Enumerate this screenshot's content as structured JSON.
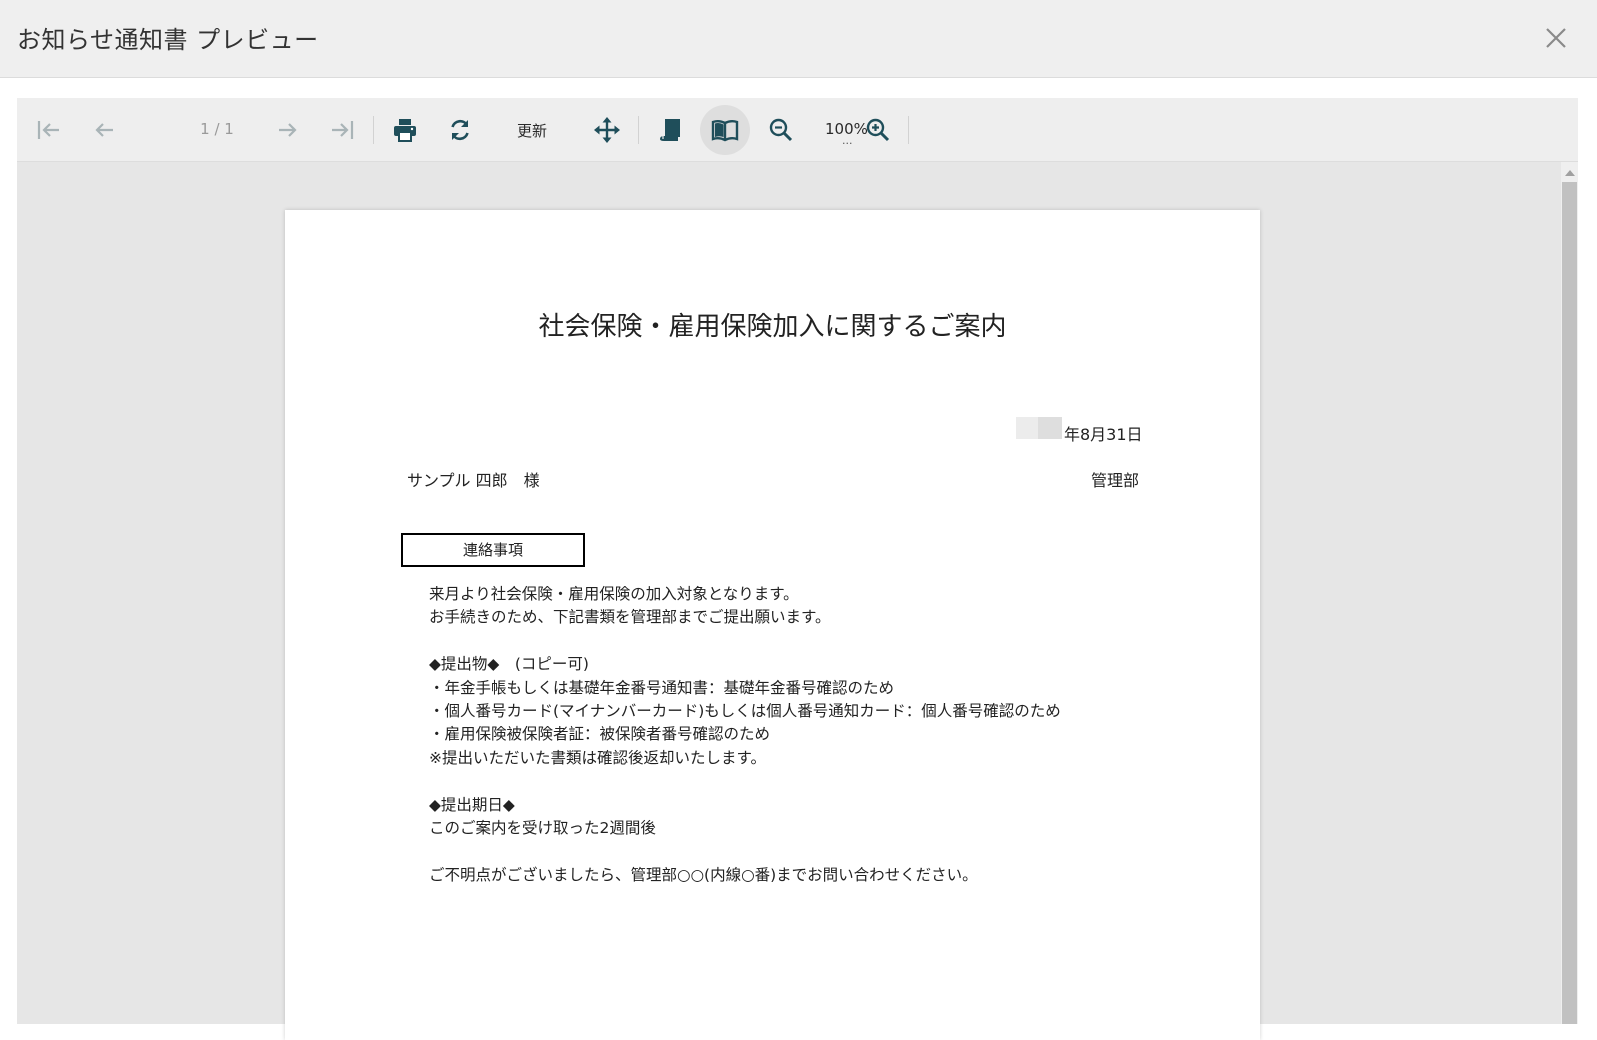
{
  "window": {
    "title": "お知らせ通知書 プレビュー",
    "close_icon": "close-icon"
  },
  "toolbar": {
    "page_info": "1 / 1",
    "refresh_label": "更新",
    "zoom_label": "100%",
    "zoom_more": "...",
    "icons": {
      "first": "first-page-icon",
      "prev": "prev-page-icon",
      "next": "next-page-icon",
      "last": "last-page-icon",
      "print": "print-icon",
      "refresh": "refresh-icon",
      "pan": "move-icon",
      "continuous": "scroll-mode-icon",
      "book": "book-view-icon",
      "zoom_out": "zoom-out-icon",
      "zoom_in": "zoom-in-icon"
    }
  },
  "document": {
    "title": "社会保険・雇用保険加入に関するご案内",
    "date_suffix": "年8月31日",
    "recipient": "サンプル 四郎　様",
    "department": "管理部",
    "section_label": "連絡事項",
    "lines": [
      "来月より社会保険・雇用保険の加入対象となります。",
      "お手続きのため、下記書類を管理部までご提出願います。",
      "",
      "◆提出物◆　(コピー可)",
      "・年金手帳もしくは基礎年金番号通知書：基礎年金番号確認のため",
      "・個人番号カード(マイナンバーカード)もしくは個人番号通知カード：個人番号確認のため",
      "・雇用保険被保険者証：被保険者番号確認のため",
      "※提出いただいた書類は確認後返却いたします。",
      "",
      "◆提出期日◆",
      "このご案内を受け取った2週間後",
      "",
      "ご不明点がございましたら、管理部○○(内線○番)までお問い合わせください。"
    ]
  },
  "colors": {
    "icon_active": "#1f4e5a",
    "icon_disabled": "#a9b4b7",
    "titlebar_bg": "#efefef",
    "viewer_bg": "#e6e6e6"
  }
}
